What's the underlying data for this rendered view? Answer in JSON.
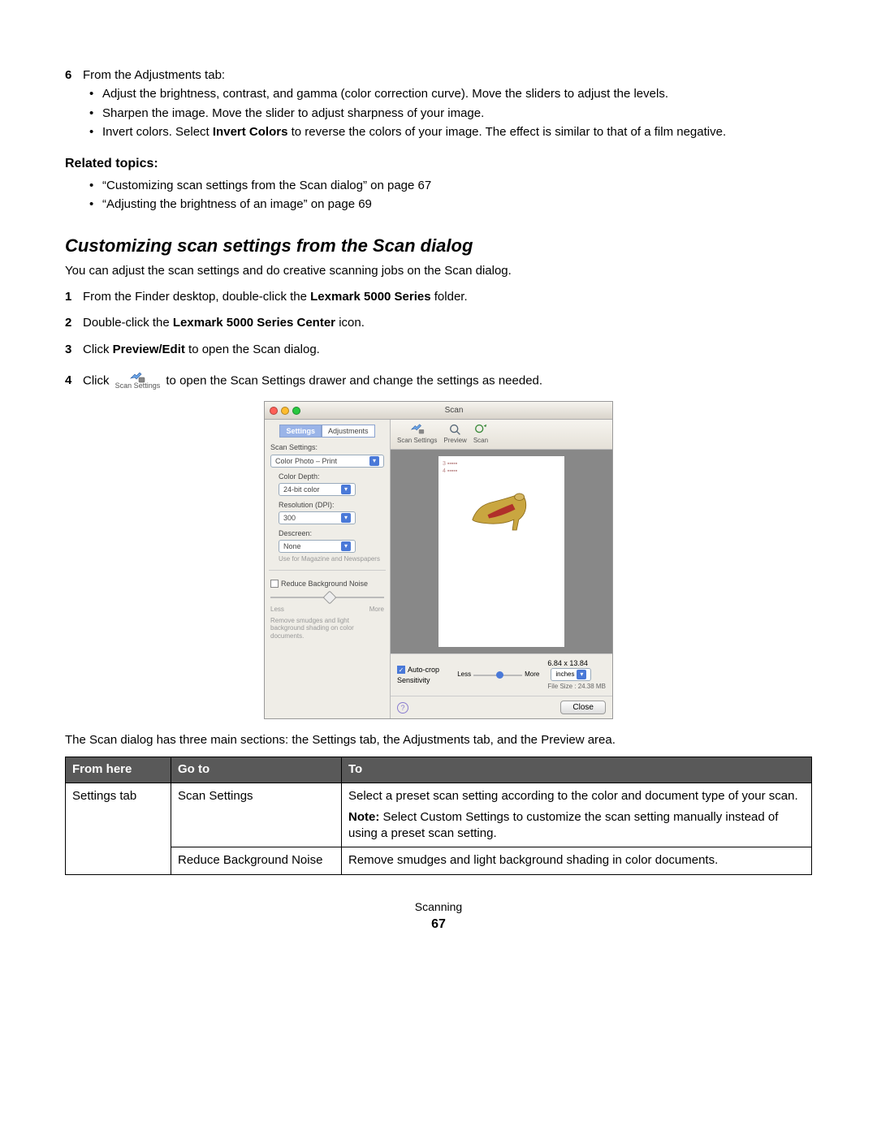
{
  "step6": {
    "n": "6",
    "intro": "From the Adjustments tab:"
  },
  "step6_bullets": [
    "Adjust the brightness, contrast, and gamma (color correction curve). Move the sliders to adjust the levels.",
    "Sharpen the image. Move the slider to adjust sharpness of your image."
  ],
  "step6_bullet3": {
    "pre": "Invert colors. Select ",
    "bold": "Invert Colors",
    "post": " to reverse the colors of your image. The effect is similar to that of a film negative."
  },
  "related_heading": "Related topics:",
  "related": [
    "“Customizing scan settings from the Scan dialog” on page 67",
    "“Adjusting the brightness of an image” on page 69"
  ],
  "h2": "Customizing scan settings from the Scan dialog",
  "intro2": "You can adjust the scan settings and do creative scanning jobs on the Scan dialog.",
  "steps": [
    {
      "n": "1",
      "pre": "From the Finder desktop, double-click the ",
      "bold": "Lexmark 5000 Series",
      "post": " folder."
    },
    {
      "n": "2",
      "pre": "Double-click the ",
      "bold": "Lexmark 5000 Series Center",
      "post": " icon."
    },
    {
      "n": "3",
      "pre": "Click ",
      "bold": "Preview/Edit",
      "post": " to open the Scan dialog."
    }
  ],
  "step4": {
    "n": "4",
    "pre": "Click ",
    "icon_label": "Scan Settings",
    "post": " to open the Scan Settings drawer and change the settings as needed."
  },
  "after_shot": "The Scan dialog has three main sections: the Settings tab, the Adjustments tab, and the Preview area.",
  "shot": {
    "title": "Scan",
    "tabs": {
      "settings": "Settings",
      "adjustments": "Adjustments"
    },
    "scan_settings_lbl": "Scan Settings:",
    "preset": "Color Photo – Print",
    "color_depth_lbl": "Color Depth:",
    "color_depth": "24-bit color",
    "res_lbl": "Resolution (DPI):",
    "res": "300",
    "descreen_lbl": "Descreen:",
    "descreen": "None",
    "descreen_hint": "Use for Magazine and Newspapers",
    "rbn": "Reduce Background Noise",
    "less": "Less",
    "more": "More",
    "rbn_hint": "Remove smudges and light background shading on color documents.",
    "toolbar": {
      "scansettings": "Scan Settings",
      "preview": "Preview",
      "scan": "Scan"
    },
    "bottom": {
      "autocrop": "Auto-crop Sensitivity",
      "less": "Less",
      "more": "More",
      "dim": "6.84 x 13.84",
      "units": "inches",
      "filesize": "File Size : 24.38 MB",
      "close": "Close"
    }
  },
  "table": {
    "headers": {
      "h1": "From here",
      "h2": "Go to",
      "h3": "To"
    },
    "r1c1": "Settings tab",
    "r1c2": "Scan Settings",
    "r1c3a": "Select a preset scan setting according to the color and document type of your scan.",
    "r1c3b_pre": "Note:",
    "r1c3b_post": " Select Custom Settings to customize the scan setting manually instead of using a preset scan setting.",
    "r2c2": "Reduce Background Noise",
    "r2c3": "Remove smudges and light background shading in color documents."
  },
  "footer": {
    "section": "Scanning",
    "page": "67"
  }
}
